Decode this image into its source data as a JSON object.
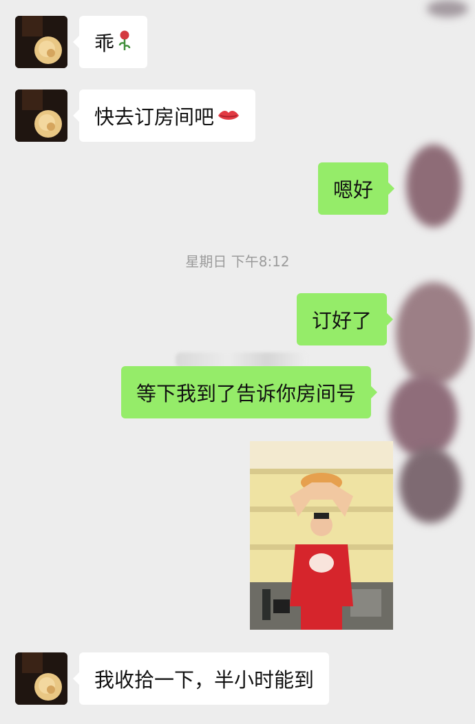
{
  "chat": {
    "timestamp": "星期日 下午8:12",
    "messages": [
      {
        "from": "contact",
        "text": "乖",
        "emoji": "rose-emoji"
      },
      {
        "from": "contact",
        "text": "快去订房间吧",
        "emoji": "lips-emoji"
      },
      {
        "from": "me",
        "text": "嗯好"
      },
      {
        "from": "me",
        "text": "订好了"
      },
      {
        "from": "me",
        "text": "等下我到了告诉你房间号"
      },
      {
        "from": "me",
        "type": "image",
        "icon": "photo-message"
      },
      {
        "from": "contact",
        "text": "我收拾一下，半小时能到"
      }
    ]
  },
  "colors": {
    "background": "#ededed",
    "outgoing_bubble": "#95ec69",
    "incoming_bubble": "#ffffff",
    "timestamp_text": "#9b9b9b"
  }
}
